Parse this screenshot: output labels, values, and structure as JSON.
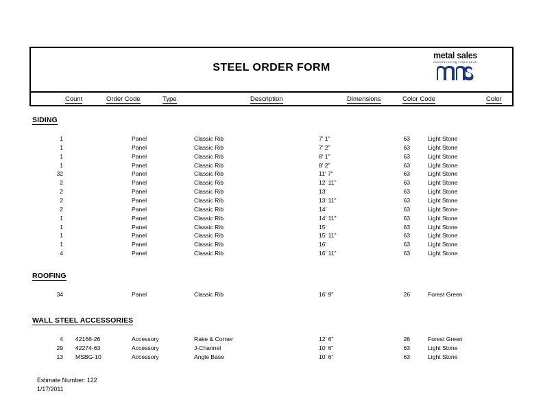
{
  "document": {
    "title": "STEEL ORDER FORM"
  },
  "logo": {
    "wordmark": "metal sales",
    "subtext": "manufacturing corporation",
    "monogram": "ms",
    "color": "#1F3A6E"
  },
  "columns": [
    {
      "key": "count",
      "label": "Count"
    },
    {
      "key": "order_code",
      "label": "Order Code"
    },
    {
      "key": "type",
      "label": "Type"
    },
    {
      "key": "description",
      "label": "Description"
    },
    {
      "key": "dimensions",
      "label": "Dimensions"
    },
    {
      "key": "color_code",
      "label": "Color Code"
    },
    {
      "key": "color",
      "label": "Color"
    }
  ],
  "sections": [
    {
      "heading": "SIDING",
      "rows": [
        {
          "count": "1",
          "order_code": "",
          "type": "Panel",
          "description": "Classic Rib",
          "dimensions": "7' 1\"",
          "color_code": "63",
          "color": "Light Stone"
        },
        {
          "count": "1",
          "order_code": "",
          "type": "Panel",
          "description": "Classic Rib",
          "dimensions": "7' 2\"",
          "color_code": "63",
          "color": "Light Stone"
        },
        {
          "count": "1",
          "order_code": "",
          "type": "Panel",
          "description": "Classic Rib",
          "dimensions": "8' 1\"",
          "color_code": "63",
          "color": "Light Stone"
        },
        {
          "count": "1",
          "order_code": "",
          "type": "Panel",
          "description": "Classic Rib",
          "dimensions": "8' 2\"",
          "color_code": "63",
          "color": "Light Stone"
        },
        {
          "count": "32",
          "order_code": "",
          "type": "Panel",
          "description": "Classic Rib",
          "dimensions": "11' 7\"",
          "color_code": "63",
          "color": "Light Stone"
        },
        {
          "count": "2",
          "order_code": "",
          "type": "Panel",
          "description": "Classic Rib",
          "dimensions": "12' 11\"",
          "color_code": "63",
          "color": "Light Stone"
        },
        {
          "count": "2",
          "order_code": "",
          "type": "Panel",
          "description": "Classic Rib",
          "dimensions": "13'",
          "color_code": "63",
          "color": "Light Stone"
        },
        {
          "count": "2",
          "order_code": "",
          "type": "Panel",
          "description": "Classic Rib",
          "dimensions": "13' 11\"",
          "color_code": "63",
          "color": "Light Stone"
        },
        {
          "count": "2",
          "order_code": "",
          "type": "Panel",
          "description": "Classic Rib",
          "dimensions": "14'",
          "color_code": "63",
          "color": "Light Stone"
        },
        {
          "count": "1",
          "order_code": "",
          "type": "Panel",
          "description": "Classic Rib",
          "dimensions": "14' 11\"",
          "color_code": "63",
          "color": "Light Stone"
        },
        {
          "count": "1",
          "order_code": "",
          "type": "Panel",
          "description": "Classic Rib",
          "dimensions": "15'",
          "color_code": "63",
          "color": "Light Stone"
        },
        {
          "count": "1",
          "order_code": "",
          "type": "Panel",
          "description": "Classic Rib",
          "dimensions": "15' 11\"",
          "color_code": "63",
          "color": "Light Stone"
        },
        {
          "count": "1",
          "order_code": "",
          "type": "Panel",
          "description": "Classic Rib",
          "dimensions": "16'",
          "color_code": "63",
          "color": "Light Stone"
        },
        {
          "count": "4",
          "order_code": "",
          "type": "Panel",
          "description": "Classic Rib",
          "dimensions": "16' 11\"",
          "color_code": "63",
          "color": "Light Stone"
        }
      ]
    },
    {
      "heading": "ROOFING",
      "rows": [
        {
          "count": "34",
          "order_code": "",
          "type": "Panel",
          "description": "Classic Rib",
          "dimensions": "16' 9\"",
          "color_code": "26",
          "color": "Forest Green"
        }
      ]
    },
    {
      "heading": "WALL STEEL ACCESSORIES",
      "rows": [
        {
          "count": "4",
          "order_code": "42166-26",
          "type": "Accessory",
          "description": "Rake & Corner",
          "dimensions": "12' 6\"",
          "color_code": "26",
          "color": "Forest Green"
        },
        {
          "count": "29",
          "order_code": "42274-63",
          "type": "Accessory",
          "description": "J-Channel",
          "dimensions": "10' 6\"",
          "color_code": "63",
          "color": "Light Stone"
        },
        {
          "count": "13",
          "order_code": "MSBG-10",
          "type": "Accessory",
          "description": "Angle Base",
          "dimensions": "10' 6\"",
          "color_code": "63",
          "color": "Light Stone"
        }
      ]
    }
  ],
  "footer": {
    "estimate_number": "Estimate Number: 122",
    "date": "1/17/2011"
  }
}
